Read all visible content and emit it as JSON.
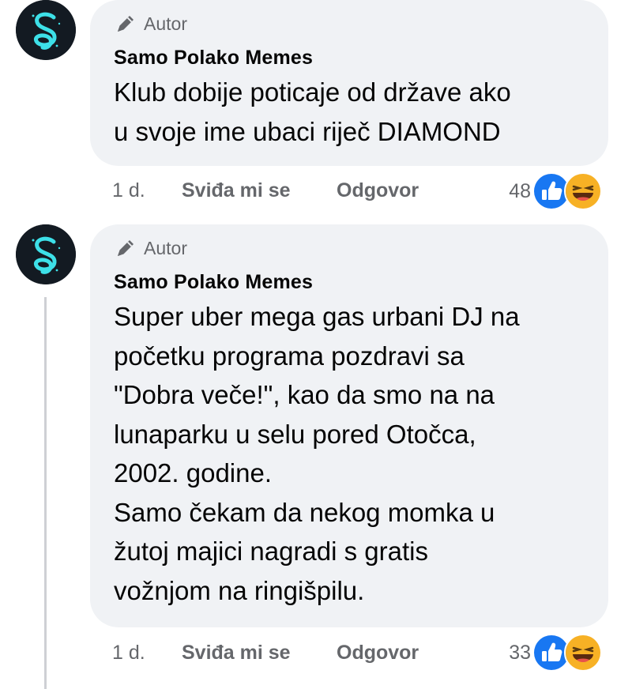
{
  "comments": [
    {
      "badge": "Autor",
      "author": "Samo Polako Memes",
      "text": "Klub dobije poticaje od države ako\nu svoje ime ubaci riječ DIAMOND",
      "time": "1 d.",
      "like_label": "Sviđa mi se",
      "reply_label": "Odgovor",
      "reaction_count": "48"
    },
    {
      "badge": "Autor",
      "author": "Samo Polako Memes",
      "text": "Super uber mega gas urbani DJ na\npočetku programa pozdravi sa\n\"Dobra veče!\", kao da smo na na\nlunaparku u selu pored Otočca,\n2002. godine.\nSamo čekam da nekog momka u\nžutoj majici nagradi s gratis\nvožnjom na ringišpilu.",
      "time": "1 d.",
      "like_label": "Sviđa mi se",
      "reply_label": "Odgovor",
      "reaction_count": "33"
    }
  ],
  "colors": {
    "bubble": "#f0f2f5",
    "secondary_text": "#65676b",
    "like_blue": "#1877f2",
    "haha_yellow": "#f7b125",
    "avatar_bg": "#131a22",
    "avatar_glow": "#3de0e8"
  },
  "icons": {
    "badge": "pen-icon",
    "like_reaction": "thumbs-up-icon",
    "haha_reaction": "laughing-face-icon",
    "avatar": "s-logo"
  }
}
